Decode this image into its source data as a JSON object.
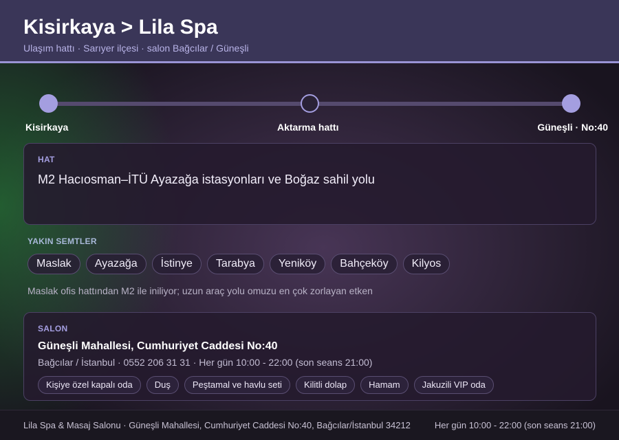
{
  "header": {
    "title": "Kisirkaya > Lila Spa",
    "subtitle": "Ulaşım hattı · Sarıyer ilçesi · salon Bağcılar / Güneşli"
  },
  "route": {
    "stops": [
      {
        "label": "Kisirkaya",
        "style": "filled"
      },
      {
        "label": "Aktarma hattı",
        "style": "hollow"
      },
      {
        "label": "Güneşli · No:40",
        "style": "filled"
      }
    ]
  },
  "line_card": {
    "label": "HAT",
    "text": "M2 Hacıosman–İTÜ Ayazağa istasyonları ve Boğaz sahil yolu"
  },
  "nearby": {
    "label": "YAKIN SEMTLER",
    "items": [
      "Maslak",
      "Ayazağa",
      "İstinye",
      "Tarabya",
      "Yeniköy",
      "Bahçeköy",
      "Kilyos"
    ],
    "note": "Maslak ofis hattından M2 ile iniliyor; uzun araç yolu omuzu en çok zorlayan etken"
  },
  "salon": {
    "label": "SALON",
    "name": "Güneşli Mahallesi, Cumhuriyet Caddesi No:40",
    "meta": "Bağcılar / İstanbul · 0552 206 31 31 · Her gün 10:00 - 22:00 (son seans 21:00)",
    "tags": [
      "Kişiye özel kapalı oda",
      "Duş",
      "Peştamal ve havlu seti",
      "Kilitli dolap",
      "Hamam",
      "Jakuzili VIP oda"
    ]
  },
  "footer": {
    "left": "Lila Spa & Masaj Salonu · Güneşli Mahallesi, Cumhuriyet Caddesi No:40, Bağcılar/İstanbul 34212",
    "right": "Her gün 10:00 - 22:00 (son seans 21:00)"
  },
  "colors": {
    "accent": "#a49ee0",
    "header_bg": "#3a3658",
    "page_bg": "#19141f"
  }
}
